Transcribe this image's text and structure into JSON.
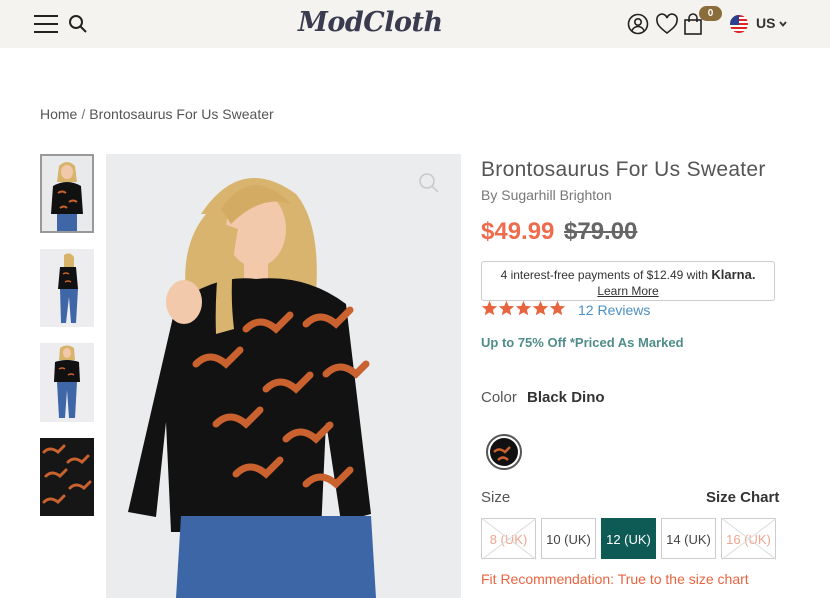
{
  "header": {
    "logo": "ModCloth",
    "bag_count": "0",
    "locale": "US",
    "icons": [
      "hamburger-menu-icon",
      "search-icon",
      "account-icon",
      "heart-icon",
      "bag-icon",
      "us-flag-icon",
      "chevron-down-icon"
    ]
  },
  "breadcrumb": {
    "home": "Home",
    "separator": "/",
    "current": "Brontosaurus For Us Sweater"
  },
  "product": {
    "title": "Brontosaurus For Us Sweater",
    "brand": "By Sugarhill Brighton",
    "sale_price": "$49.99",
    "original_price": "$79.00",
    "klarna_text": "4 interest-free payments of $12.49 with",
    "klarna_brand": "Klarna.",
    "klarna_link": "Learn More",
    "rating_stars": 5,
    "reviews": "12 Reviews",
    "promo": "Up to 75% Off *Priced As Marked",
    "color_label": "Color",
    "color_value": "Black Dino",
    "size_label": "Size",
    "size_chart": "Size Chart",
    "sizes": [
      {
        "label": "8 (UK)",
        "state": "unavailable"
      },
      {
        "label": "10 (UK)",
        "state": "available"
      },
      {
        "label": "12 (UK)",
        "state": "selected"
      },
      {
        "label": "14 (UK)",
        "state": "available"
      },
      {
        "label": "16 (UK)",
        "state": "unavailable"
      }
    ],
    "fit_recommendation": "Fit Recommendation: True to the size chart"
  },
  "colors": {
    "header_bg": "#f5f3ef",
    "sale": "#ef6b4c",
    "promo": "#4f8d8a",
    "selected_size": "#0e5b55",
    "link": "#4a90c4",
    "star": "#e8643f",
    "bag_badge": "#8a6d3b"
  }
}
